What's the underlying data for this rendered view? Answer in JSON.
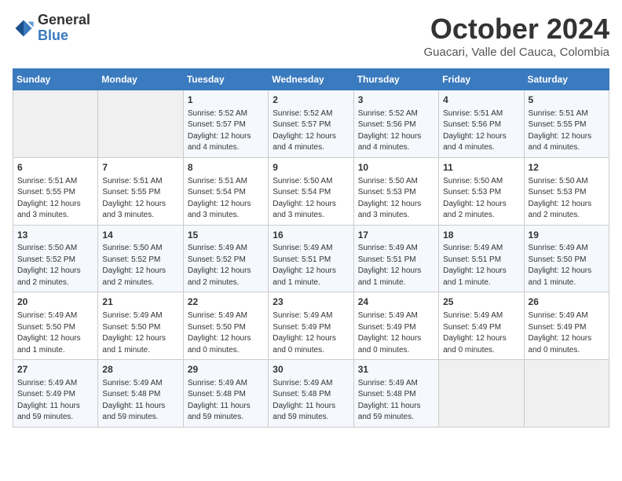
{
  "header": {
    "logo_general": "General",
    "logo_blue": "Blue",
    "month_title": "October 2024",
    "location": "Guacari, Valle del Cauca, Colombia"
  },
  "weekdays": [
    "Sunday",
    "Monday",
    "Tuesday",
    "Wednesday",
    "Thursday",
    "Friday",
    "Saturday"
  ],
  "weeks": [
    [
      {
        "day": "",
        "empty": true
      },
      {
        "day": "",
        "empty": true
      },
      {
        "day": "1",
        "sunrise": "5:52 AM",
        "sunset": "5:57 PM",
        "daylight": "12 hours and 4 minutes."
      },
      {
        "day": "2",
        "sunrise": "5:52 AM",
        "sunset": "5:57 PM",
        "daylight": "12 hours and 4 minutes."
      },
      {
        "day": "3",
        "sunrise": "5:52 AM",
        "sunset": "5:56 PM",
        "daylight": "12 hours and 4 minutes."
      },
      {
        "day": "4",
        "sunrise": "5:51 AM",
        "sunset": "5:56 PM",
        "daylight": "12 hours and 4 minutes."
      },
      {
        "day": "5",
        "sunrise": "5:51 AM",
        "sunset": "5:55 PM",
        "daylight": "12 hours and 4 minutes."
      }
    ],
    [
      {
        "day": "6",
        "sunrise": "5:51 AM",
        "sunset": "5:55 PM",
        "daylight": "12 hours and 3 minutes."
      },
      {
        "day": "7",
        "sunrise": "5:51 AM",
        "sunset": "5:55 PM",
        "daylight": "12 hours and 3 minutes."
      },
      {
        "day": "8",
        "sunrise": "5:51 AM",
        "sunset": "5:54 PM",
        "daylight": "12 hours and 3 minutes."
      },
      {
        "day": "9",
        "sunrise": "5:50 AM",
        "sunset": "5:54 PM",
        "daylight": "12 hours and 3 minutes."
      },
      {
        "day": "10",
        "sunrise": "5:50 AM",
        "sunset": "5:53 PM",
        "daylight": "12 hours and 3 minutes."
      },
      {
        "day": "11",
        "sunrise": "5:50 AM",
        "sunset": "5:53 PM",
        "daylight": "12 hours and 2 minutes."
      },
      {
        "day": "12",
        "sunrise": "5:50 AM",
        "sunset": "5:53 PM",
        "daylight": "12 hours and 2 minutes."
      }
    ],
    [
      {
        "day": "13",
        "sunrise": "5:50 AM",
        "sunset": "5:52 PM",
        "daylight": "12 hours and 2 minutes."
      },
      {
        "day": "14",
        "sunrise": "5:50 AM",
        "sunset": "5:52 PM",
        "daylight": "12 hours and 2 minutes."
      },
      {
        "day": "15",
        "sunrise": "5:49 AM",
        "sunset": "5:52 PM",
        "daylight": "12 hours and 2 minutes."
      },
      {
        "day": "16",
        "sunrise": "5:49 AM",
        "sunset": "5:51 PM",
        "daylight": "12 hours and 1 minute."
      },
      {
        "day": "17",
        "sunrise": "5:49 AM",
        "sunset": "5:51 PM",
        "daylight": "12 hours and 1 minute."
      },
      {
        "day": "18",
        "sunrise": "5:49 AM",
        "sunset": "5:51 PM",
        "daylight": "12 hours and 1 minute."
      },
      {
        "day": "19",
        "sunrise": "5:49 AM",
        "sunset": "5:50 PM",
        "daylight": "12 hours and 1 minute."
      }
    ],
    [
      {
        "day": "20",
        "sunrise": "5:49 AM",
        "sunset": "5:50 PM",
        "daylight": "12 hours and 1 minute."
      },
      {
        "day": "21",
        "sunrise": "5:49 AM",
        "sunset": "5:50 PM",
        "daylight": "12 hours and 1 minute."
      },
      {
        "day": "22",
        "sunrise": "5:49 AM",
        "sunset": "5:50 PM",
        "daylight": "12 hours and 0 minutes."
      },
      {
        "day": "23",
        "sunrise": "5:49 AM",
        "sunset": "5:49 PM",
        "daylight": "12 hours and 0 minutes."
      },
      {
        "day": "24",
        "sunrise": "5:49 AM",
        "sunset": "5:49 PM",
        "daylight": "12 hours and 0 minutes."
      },
      {
        "day": "25",
        "sunrise": "5:49 AM",
        "sunset": "5:49 PM",
        "daylight": "12 hours and 0 minutes."
      },
      {
        "day": "26",
        "sunrise": "5:49 AM",
        "sunset": "5:49 PM",
        "daylight": "12 hours and 0 minutes."
      }
    ],
    [
      {
        "day": "27",
        "sunrise": "5:49 AM",
        "sunset": "5:49 PM",
        "daylight": "11 hours and 59 minutes."
      },
      {
        "day": "28",
        "sunrise": "5:49 AM",
        "sunset": "5:48 PM",
        "daylight": "11 hours and 59 minutes."
      },
      {
        "day": "29",
        "sunrise": "5:49 AM",
        "sunset": "5:48 PM",
        "daylight": "11 hours and 59 minutes."
      },
      {
        "day": "30",
        "sunrise": "5:49 AM",
        "sunset": "5:48 PM",
        "daylight": "11 hours and 59 minutes."
      },
      {
        "day": "31",
        "sunrise": "5:49 AM",
        "sunset": "5:48 PM",
        "daylight": "11 hours and 59 minutes."
      },
      {
        "day": "",
        "empty": true
      },
      {
        "day": "",
        "empty": true
      }
    ]
  ],
  "labels": {
    "sunrise": "Sunrise:",
    "sunset": "Sunset:",
    "daylight": "Daylight:"
  }
}
